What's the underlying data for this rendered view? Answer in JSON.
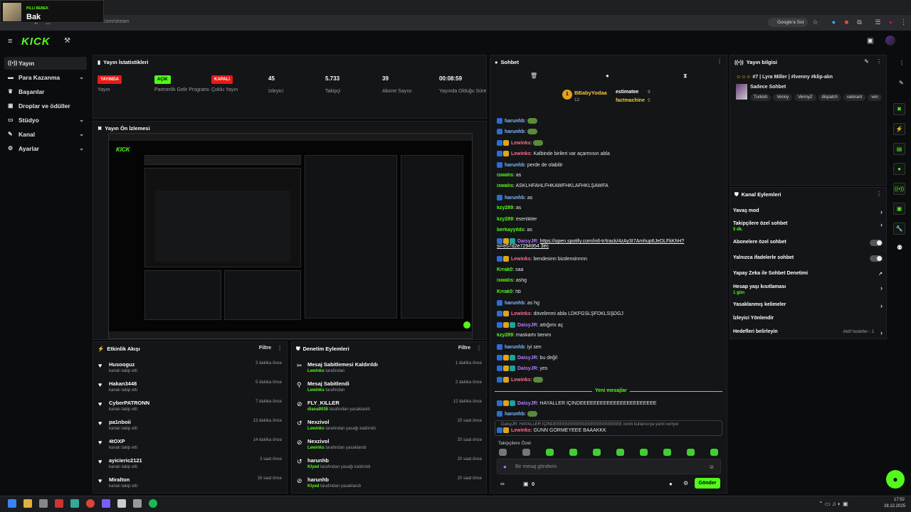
{
  "browser": {
    "url": "dashboard.kick.com/stream",
    "google_btn": "Google'a Sor"
  },
  "notification": {
    "sender": "PILLI BEBEK",
    "message": "Bak"
  },
  "brand": {
    "logo": "KICK",
    "accent": "#53fc18"
  },
  "sidebar": {
    "items": [
      {
        "label": "Yayın",
        "icon": "stream-icon"
      },
      {
        "label": "Para Kazanma",
        "icon": "money-icon"
      },
      {
        "label": "Başarılar",
        "icon": "trophy-icon"
      },
      {
        "label": "Droplar ve ödüller",
        "icon": "gift-icon"
      },
      {
        "label": "Stüdyo",
        "icon": "studio-icon"
      },
      {
        "label": "Kanal",
        "icon": "channel-icon"
      },
      {
        "label": "Ayarlar",
        "icon": "gear-icon"
      }
    ]
  },
  "stats": {
    "title": "Yayın İstatistikleri",
    "items": [
      {
        "badge": "YAYINDA",
        "label": "Yayın"
      },
      {
        "badge": "AÇIK",
        "label": "Partnerlik Gelir Programı"
      },
      {
        "badge": "KAPALI",
        "label": "Çoklu Yayın"
      },
      {
        "value": "45",
        "label": "İzleyici"
      },
      {
        "value": "5.733",
        "label": "Takipçi"
      },
      {
        "value": "39",
        "label": "Abone Sayısı"
      },
      {
        "value": "00:08:59",
        "label": "Yayında Olduğu Süre"
      }
    ]
  },
  "preview": {
    "title": "Yayın Ön İzlemesi"
  },
  "events": {
    "title": "Etkinlik Akışı",
    "filter": "Filtre",
    "items": [
      {
        "name": "Husooguz",
        "sub": "kanalı takip etti",
        "time": "3 dakika önce"
      },
      {
        "name": "Hakan3448",
        "sub": "kanalı takip etti",
        "time": "5 dakika önce"
      },
      {
        "name": "CyberPATRONN",
        "sub": "kanalı takip etti",
        "time": "7 dakika önce"
      },
      {
        "name": "pa1nboii",
        "sub": "kanalı takip etti",
        "time": "13 dakika önce"
      },
      {
        "name": "4tOXP",
        "sub": "kanalı takip etti",
        "time": "14 dakika önce"
      },
      {
        "name": "ayicieric2121",
        "sub": "kanalı takip etti",
        "time": "3 saat önce"
      },
      {
        "name": "Miralton",
        "sub": "kanalı takip etti",
        "time": "16 saat önce"
      }
    ]
  },
  "moderation": {
    "title": "Denetim Eylemleri",
    "filter": "Filtre",
    "items": [
      {
        "name": "Mesaj Sabitlemesi Kaldırıldı",
        "actor": "Lewinks",
        "sub": "tarafından",
        "time": "1 dakika önce"
      },
      {
        "name": "Mesaj Sabitlendi",
        "actor": "Lewinks",
        "sub": "tarafından",
        "time": "2 dakika önce"
      },
      {
        "name": "FLY_KILLER",
        "actor": "diana0035",
        "sub": "tarafından yasaklandı",
        "time": "12 dakika önce"
      },
      {
        "name": "Nexzivol",
        "actor": "Lewinks",
        "sub": "tarafından yasağı kaldırıldı",
        "time": "20 saat önce"
      },
      {
        "name": "Nexzivol",
        "actor": "Lewinks",
        "sub": "tarafından yasaklandı",
        "time": "20 saat önce"
      },
      {
        "name": "harunhb",
        "actor": "Klyed",
        "sub": "tarafından yasağı kaldırıldı",
        "time": "20 saat önce"
      },
      {
        "name": "harunhb",
        "actor": "Klyed",
        "sub": "tarafından yasaklandı",
        "time": "20 saat önce"
      }
    ]
  },
  "chat": {
    "title": "Sohbet",
    "top_gifters": [
      {
        "name": "BBabyYodaa",
        "count": "12"
      },
      {
        "name": "estimatee",
        "count": "9"
      },
      {
        "name": "factmachine",
        "count": "5"
      }
    ],
    "messages": [
      {
        "user": "harunhb",
        "text": ""
      },
      {
        "user": "harunhb",
        "text": ""
      },
      {
        "user": "Lewinks",
        "text": ""
      },
      {
        "user": "Lewinks",
        "text": "Kalbinde birileri var açarmısın abla"
      },
      {
        "user": "harunhb",
        "text": "perde de olabilir"
      },
      {
        "user": "iswalis",
        "text": "as"
      },
      {
        "user": "iswalis",
        "text": "ASKLHFAHLFHKAWFHKLAFHKLŞAWFA"
      },
      {
        "user": "harunhb",
        "text": "as"
      },
      {
        "user": "kzy289",
        "text": "as"
      },
      {
        "user": "kzy289",
        "text": "esenlikler"
      },
      {
        "user": "berkayyilds",
        "text": "as"
      },
      {
        "user": "DaisyJR",
        "text": "https://open.spotify.com/intl-tr/track/4zAy3I7Amhup6JeDLFkKhH?si=e57d2e7294954 3ec"
      },
      {
        "user": "Lewinks",
        "text": "bendesinn bizdensinnnn"
      },
      {
        "user": "Krrak0",
        "text": "saa"
      },
      {
        "user": "iswalis",
        "text": "ashg"
      },
      {
        "user": "Krrak0",
        "text": "hb"
      },
      {
        "user": "harunhb",
        "text": "as hg"
      },
      {
        "user": "Lewinks",
        "text": "dövelimmi abla LDKFGSLŞFDKLSŞDGJ"
      },
      {
        "user": "DaisyJR",
        "text": "attığımı aç"
      },
      {
        "user": "kzy289",
        "text": "maskartv benim"
      },
      {
        "user": "harunhb",
        "text": "iyi sen"
      },
      {
        "user": "DaisyJR",
        "text": "bu değil"
      },
      {
        "user": "DaisyJR",
        "text": "yes"
      },
      {
        "user": "Lewinks",
        "text": ""
      }
    ],
    "new_messages_label": "Yeni mesajlar",
    "after_new": [
      {
        "user": "DaisyJR",
        "text": "HAYALLER İÇİNDEEEEEEEEEEEEEEEEEEEEEEE"
      },
      {
        "user": "harunhb",
        "text": ""
      }
    ],
    "reply_context": "DaisyJR: HAYALLER İÇİNDEEEEEEEEEEEEEEEEEEEEEEEE isimli kullanıcıya yanıt veriyor",
    "reply_message": {
      "user": "Lewinks",
      "text": "GÜNN GÖRMEYEEE BAAAKKK"
    },
    "followers_only": "Takipçilere Özel",
    "input_placeholder": "Bir mesaj gönderin",
    "send_label": "Gönder",
    "count_zero": "0"
  },
  "stream_info": {
    "title": "Yayın bilgisi",
    "stream_title": "#7 | Lyra Miller | #lvenny #klip-alın",
    "category": "Sadece Sohbet",
    "tags": [
      "Turkish",
      "Venny",
      "VennyZ",
      "dispatch",
      "valorant",
      "ven"
    ]
  },
  "channel_actions": {
    "title": "Kanal Eylemleri",
    "items": [
      {
        "label": "Yavaş mod",
        "sub": "",
        "control": "arrow"
      },
      {
        "label": "Takipçilere özel sohbet",
        "sub": "5 dk.",
        "control": "arrow"
      },
      {
        "label": "Abonelere özel sohbet",
        "sub": "",
        "control": "toggle"
      },
      {
        "label": "Yalnızca ifadelerle sohbet",
        "sub": "",
        "control": "toggle"
      },
      {
        "label": "Yapay Zeka ile Sohbet Denetimi",
        "sub": "",
        "control": "external"
      },
      {
        "label": "Hesap yaşı kısıtlaması",
        "sub": "1 gün",
        "control": "arrow"
      },
      {
        "label": "Yasaklanmış kelimeler",
        "sub": "",
        "control": "arrow"
      },
      {
        "label": "İzleyici Yönlendir",
        "sub": "",
        "control": "none"
      },
      {
        "label": "Hedefleri belirleyin",
        "sub": "",
        "control": "arrow",
        "status": "Aktif hedefler - 1"
      }
    ]
  },
  "taskbar": {
    "time": "17:52",
    "date": "28.12.2025"
  }
}
